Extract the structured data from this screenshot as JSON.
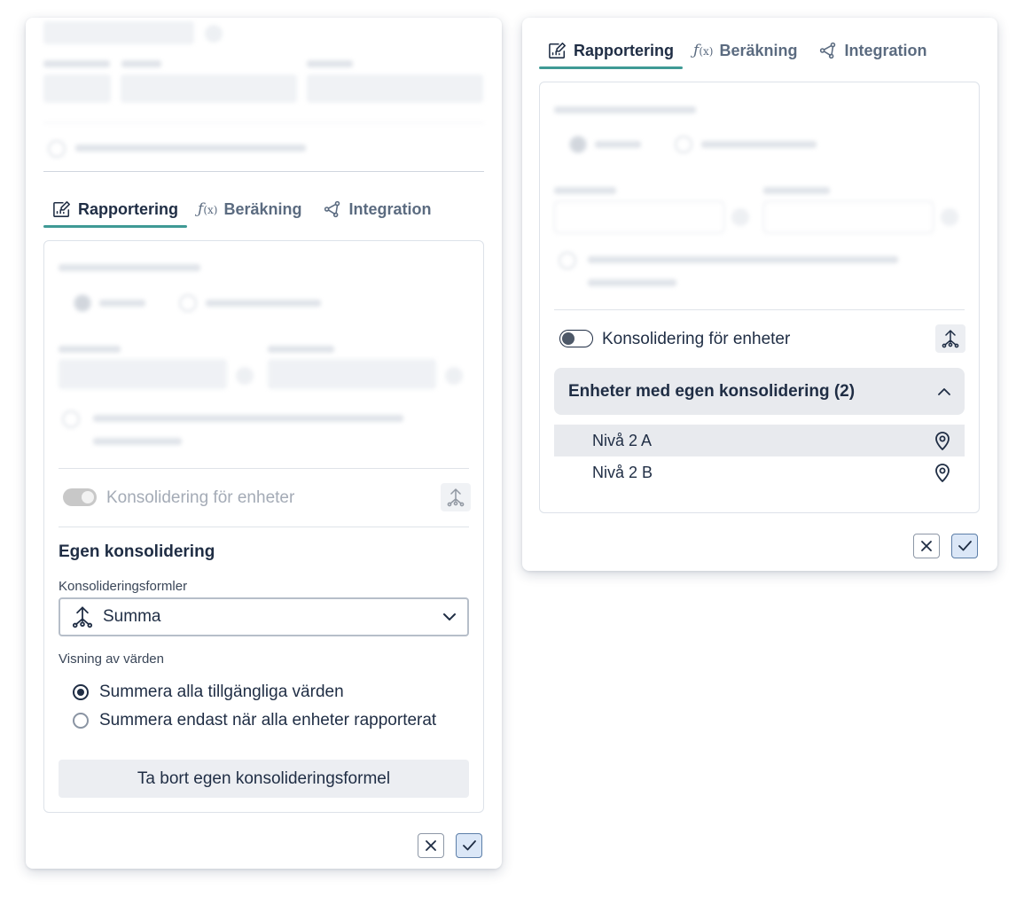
{
  "tabs": {
    "reporting": "Rapportering",
    "calculation": "Beräkning",
    "integration": "Integration"
  },
  "consolidation_toggle_label": "Konsolidering för enheter",
  "left": {
    "section_title": "Egen konsolidering",
    "formulas_label": "Konsolideringsformler",
    "formula_selected": "Summa",
    "display_label": "Visning av värden",
    "radio_options": [
      {
        "label": "Summera alla tillgängliga värden",
        "selected": true
      },
      {
        "label": "Summera endast när alla enheter rapporterat",
        "selected": false
      }
    ],
    "remove_button": "Ta bort egen konsolideringsformel"
  },
  "right": {
    "accordion_title": "Enheter med egen konsolidering (2)",
    "units": [
      "Nivå 2 A",
      "Nivå 2 B"
    ]
  },
  "colors": {
    "accent": "#3f9a95",
    "text": "#1f2d44",
    "confirm_bg": "#dbe7f7"
  },
  "icons": {
    "reporting": "edit-chart-icon",
    "calculation": "function-icon",
    "integration": "share-node-icon",
    "consolidation": "tree-merge-icon",
    "location": "map-pin-icon"
  }
}
